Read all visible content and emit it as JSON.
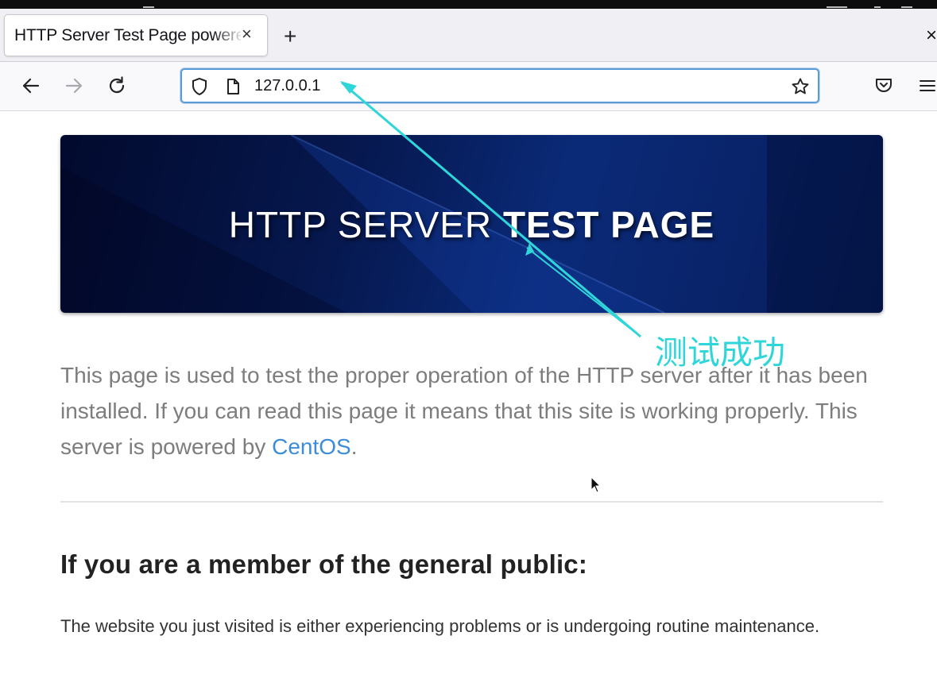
{
  "browser": {
    "tab": {
      "title": "HTTP Server Test Page powered by CentOS",
      "close_glyph": "×"
    },
    "new_tab_glyph": "+",
    "window_close_glyph": "×",
    "address": {
      "url": "127.0.0.1"
    },
    "icons": {
      "back": "arrow-left-icon",
      "forward": "arrow-right-icon",
      "reload": "reload-icon",
      "tracking": "shield-icon",
      "page": "page-icon",
      "bookmark": "star-icon",
      "pocket": "pocket-icon",
      "menu": "hamburger-menu-icon"
    }
  },
  "page": {
    "banner": {
      "title_light": "HTTP SERVER ",
      "title_bold": "TEST PAGE"
    },
    "intro": {
      "text": "This page is used to test the proper operation of the HTTP server after it has been installed. If you can read this page it means that this site is working properly. This server is powered by ",
      "link": "CentOS",
      "after": "."
    },
    "section": {
      "heading": "If you are a member of the general public:",
      "body": "The website you just visited is either experiencing problems or is undergoing routine maintenance."
    }
  },
  "annotation": {
    "label": "测试成功",
    "color": "#2ed6d9"
  },
  "colors": {
    "banner_dark": "#020a2d",
    "banner_mid": "#0a2a78",
    "link": "#3c8dd9",
    "url_focus": "#5b9bd5"
  }
}
